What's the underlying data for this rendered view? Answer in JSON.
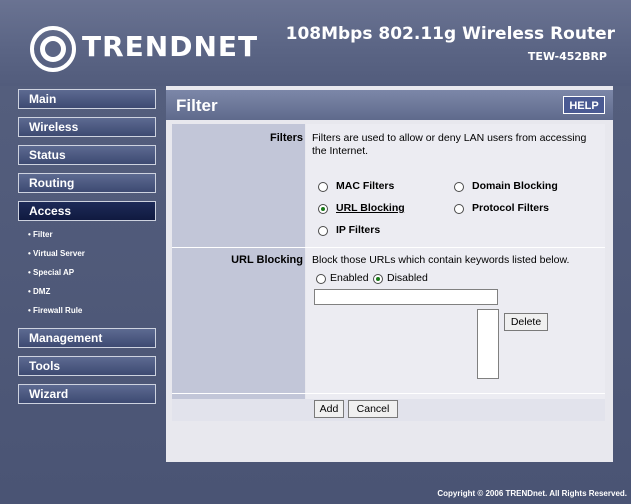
{
  "header": {
    "brand": "TRENDNET",
    "product": "108Mbps 802.11g Wireless Router",
    "model": "TEW-452BRP"
  },
  "sidebar": {
    "items": [
      {
        "label": "Main"
      },
      {
        "label": "Wireless"
      },
      {
        "label": "Status"
      },
      {
        "label": "Routing"
      },
      {
        "label": "Access"
      },
      {
        "label": "Management"
      },
      {
        "label": "Tools"
      },
      {
        "label": "Wizard"
      }
    ],
    "access_sub": [
      {
        "label": "Filter"
      },
      {
        "label": "Virtual Server"
      },
      {
        "label": "Special AP"
      },
      {
        "label": "DMZ"
      },
      {
        "label": "Firewall Rule"
      }
    ]
  },
  "panel": {
    "title": "Filter",
    "help_label": "HELP",
    "filters": {
      "label": "Filters",
      "description": "Filters are used to allow or deny LAN users from accessing the Internet.",
      "options": [
        {
          "label": "MAC Filters",
          "checked": false
        },
        {
          "label": "Domain Blocking",
          "checked": false
        },
        {
          "label": "URL Blocking",
          "checked": true
        },
        {
          "label": "Protocol Filters",
          "checked": false
        },
        {
          "label": "IP Filters",
          "checked": false
        }
      ]
    },
    "url_blocking": {
      "label": "URL Blocking",
      "description": "Block those URLs which contain keywords listed below.",
      "enabled_label": "Enabled",
      "disabled_label": "Disabled",
      "state": "Disabled",
      "keyword_value": "",
      "delete_label": "Delete"
    },
    "actions": {
      "add_label": "Add",
      "cancel_label": "Cancel"
    }
  },
  "footer": {
    "copyright": "Copyright © 2006 TRENDnet. All Rights Reserved."
  },
  "colors": {
    "frame": "#56607f",
    "nav_button": "#4a5780",
    "nav_active": "#1a2550",
    "label_column": "#c2c6d8",
    "content_column": "#ececf2",
    "panel_header": "#6b7697"
  }
}
